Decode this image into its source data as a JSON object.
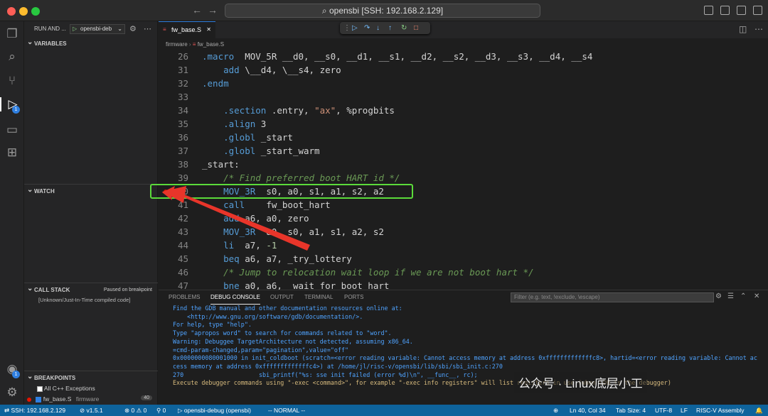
{
  "titlebar": {
    "search": "opensbi [SSH: 192.168.2.129]"
  },
  "sidebar": {
    "run_label": "RUN AND ...",
    "config": "opensbi-deb",
    "variables": "VARIABLES",
    "watch": "WATCH",
    "call_stack": "CALL STACK",
    "paused": "Paused on breakpoint",
    "stack_frame": "[Unknown/Just-In-Time compiled code]",
    "breakpoints": "BREAKPOINTS",
    "bp_all": "All C++ Exceptions",
    "bp_file": "fw_base.S",
    "bp_dir": "firmware",
    "bp_line": "40"
  },
  "activity": {
    "debug_badge": "1",
    "account_badge": "1"
  },
  "editor": {
    "tab": "fw_base.S",
    "crumb_dir": "firmware",
    "crumb_file": "fw_base.S",
    "lines": [
      {
        "n": "26",
        "t": ".macro  MOV_5R __d0, __s0, __d1, __s1, __d2, __s2, __d3, __s3, __d4, __s4"
      },
      {
        "n": "31",
        "t": "    add \\__d4, \\__s4, zero"
      },
      {
        "n": "32",
        "t": ".endm"
      },
      {
        "n": "33",
        "t": ""
      },
      {
        "n": "34",
        "t": "    .section .entry, \"ax\", %progbits"
      },
      {
        "n": "35",
        "t": "    .align 3"
      },
      {
        "n": "36",
        "t": "    .globl _start"
      },
      {
        "n": "37",
        "t": "    .globl _start_warm"
      },
      {
        "n": "38",
        "t": "_start:"
      },
      {
        "n": "39",
        "t": "    /* Find preferred boot HART id */"
      },
      {
        "n": "40",
        "t": "    MOV_3R  s0, a0, s1, a1, s2, a2"
      },
      {
        "n": "41",
        "t": "    call    fw_boot_hart"
      },
      {
        "n": "42",
        "t": "    add a6, a0, zero"
      },
      {
        "n": "43",
        "t": "    MOV_3R  a0, s0, a1, s1, a2, s2"
      },
      {
        "n": "44",
        "t": "    li  a7, -1"
      },
      {
        "n": "45",
        "t": "    beq a6, a7, _try_lottery"
      },
      {
        "n": "46",
        "t": "    /* Jump to relocation wait loop if we are not boot hart */"
      },
      {
        "n": "47",
        "t": "    bne a0, a6, _wait_for_boot_hart"
      }
    ]
  },
  "panel": {
    "tabs": [
      "PROBLEMS",
      "DEBUG CONSOLE",
      "OUTPUT",
      "TERMINAL",
      "PORTS"
    ],
    "filter_placeholder": "Filter (e.g. text, !exclude, \\escape)",
    "console": [
      "Find the GDB manual and other documentation resources online at:",
      "    <http://www.gnu.org/software/gdb/documentation/>.",
      "",
      "For help, type \"help\".",
      "Type \"apropos word\" to search for commands related to \"word\".",
      "Warning: Debuggee TargetArchitecture not detected, assuming x86_64.",
      "=cmd-param-changed,param=\"pagination\",value=\"off\"",
      "0x0000000080001000 in init_coldboot (scratch=<error reading variable: Cannot access memory at address 0xfffffffffffffc8>, hartid=<error reading variable: Cannot ac",
      "cess memory at address 0xfffffffffffffc4>) at /home/jl/risc-v/opensbi/lib/sbi/sbi_init.c:270",
      "270                     sbi_printf(\"%s: sse init failed (error %d)\\n\", __func__, rc);",
      "Execute debugger commands using \"-exec <command>\", for example \"-exec info registers\" will list registers in use (when GDB is the debugger)"
    ]
  },
  "watermark": "公众号 · Linux底层小工",
  "status": {
    "remote": "SSH: 192.168.2.129",
    "version": "v1.5.1",
    "errors": "0",
    "warnings": "0",
    "ports": "0",
    "debug": "opensbi-debug (opensbi)",
    "mode": "-- NORMAL --",
    "pos": "Ln 40, Col 34",
    "tab": "Tab Size: 4",
    "enc": "UTF-8",
    "eol": "LF",
    "lang": "RISC-V Assembly"
  },
  "colors": {
    "accent": "#0e639c",
    "highlight_box": "#5bdb3a",
    "arrow": "#e8352a",
    "breakpoint": "#e51400"
  }
}
